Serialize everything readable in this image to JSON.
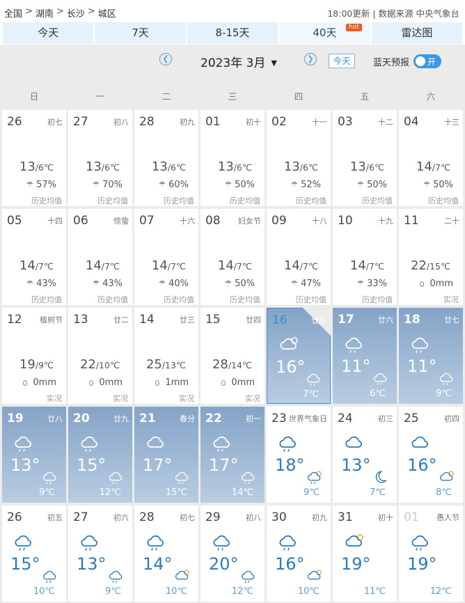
{
  "breadcrumb": [
    "全国",
    "湖南",
    "长沙",
    "城区"
  ],
  "breadcrumb_sep": ">",
  "update_text": "18:00更新 | 数据来源 中央气象台",
  "tabs": [
    {
      "label": "今天"
    },
    {
      "label": "7天"
    },
    {
      "label": "8-15天"
    },
    {
      "label": "40天",
      "badge": "hot",
      "active": true
    },
    {
      "label": "雷达图"
    }
  ],
  "month_label": "2023年  3月",
  "today_label": "今天",
  "lanbei_label": "蓝天预报",
  "toggle_label": "开",
  "weekdays": [
    "日",
    "一",
    "二",
    "三",
    "四",
    "五",
    "六"
  ],
  "colors": {
    "accent": "#3c8ad8",
    "forecast_bg": "#84a3c6",
    "temp_blue": "#2a7bc0"
  },
  "days": [
    {
      "d": "26",
      "lunar": "初七",
      "type": "hist",
      "high": "13",
      "low": "/6℃",
      "p": "57%",
      "note": "历史均值"
    },
    {
      "d": "27",
      "lunar": "初八",
      "type": "hist",
      "high": "13",
      "low": "/6℃",
      "p": "70%",
      "note": "历史均值"
    },
    {
      "d": "28",
      "lunar": "初九",
      "type": "hist",
      "high": "13",
      "low": "/6℃",
      "p": "60%",
      "note": "历史均值"
    },
    {
      "d": "01",
      "lunar": "初十",
      "type": "hist",
      "high": "13",
      "low": "/6℃",
      "p": "50%",
      "note": "历史均值"
    },
    {
      "d": "02",
      "lunar": "十一",
      "type": "hist",
      "high": "13",
      "low": "/6℃",
      "p": "52%",
      "note": "历史均值"
    },
    {
      "d": "03",
      "lunar": "十二",
      "type": "hist",
      "high": "13",
      "low": "/6℃",
      "p": "50%",
      "note": "历史均值"
    },
    {
      "d": "04",
      "lunar": "十三",
      "type": "hist",
      "high": "14",
      "low": "/7℃",
      "p": "50%",
      "note": "历史均值"
    },
    {
      "d": "05",
      "lunar": "十四",
      "type": "hist",
      "high": "14",
      "low": "/7℃",
      "p": "43%",
      "note": "历史均值"
    },
    {
      "d": "06",
      "lunar": "惊蛰",
      "type": "hist",
      "high": "14",
      "low": "/7℃",
      "p": "43%",
      "note": "历史均值"
    },
    {
      "d": "07",
      "lunar": "十六",
      "type": "hist",
      "high": "14",
      "low": "/7℃",
      "p": "40%",
      "note": "历史均值"
    },
    {
      "d": "08",
      "lunar": "妇女节",
      "type": "hist",
      "high": "14",
      "low": "/7℃",
      "p": "50%",
      "note": "历史均值"
    },
    {
      "d": "09",
      "lunar": "十八",
      "type": "hist",
      "high": "14",
      "low": "/7℃",
      "p": "47%",
      "note": "历史均值"
    },
    {
      "d": "10",
      "lunar": "十九",
      "type": "hist",
      "high": "14",
      "low": "/7℃",
      "p": "33%",
      "note": "历史均值"
    },
    {
      "d": "11",
      "lunar": "二十",
      "type": "actual",
      "high": "22",
      "low": "/15℃",
      "p": "0mm",
      "note": "实况"
    },
    {
      "d": "12",
      "lunar": "植树节",
      "type": "actual",
      "high": "19",
      "low": "/9℃",
      "p": "0mm",
      "note": "实况"
    },
    {
      "d": "13",
      "lunar": "廿二",
      "type": "actual",
      "high": "22",
      "low": "/10℃",
      "p": "0mm",
      "note": "实况"
    },
    {
      "d": "14",
      "lunar": "廿三",
      "type": "actual",
      "high": "25",
      "low": "/13℃",
      "p": "1mm",
      "note": "实况"
    },
    {
      "d": "15",
      "lunar": "廿四",
      "type": "actual",
      "high": "28",
      "low": "/14℃",
      "p": "0mm",
      "note": "实况"
    },
    {
      "d": "16",
      "lunar": "廿五",
      "type": "fc",
      "cur": true,
      "today": true,
      "icon": "sun-cloud",
      "icon2": "cloud-rain",
      "high": "16°",
      "low": "7℃"
    },
    {
      "d": "17",
      "lunar": "廿六",
      "type": "fc",
      "cur": true,
      "icon": "cloud-rain",
      "icon2": "cloud-rain",
      "high": "11°",
      "low": "6℃"
    },
    {
      "d": "18",
      "lunar": "廿七",
      "type": "fc",
      "cur": true,
      "icon": "cloud-rain",
      "icon2": "cloud-rain",
      "high": "11°",
      "low": "9℃"
    },
    {
      "d": "19",
      "lunar": "廿八",
      "type": "fc",
      "cur": true,
      "icon": "cloud-rain",
      "icon2": "cloud-rain",
      "high": "13°",
      "low": "9℃"
    },
    {
      "d": "20",
      "lunar": "廿九",
      "type": "fc",
      "cur": true,
      "icon": "cloud-rain",
      "icon2": "cloud-rain",
      "high": "15°",
      "low": "12℃"
    },
    {
      "d": "21",
      "lunar": "春分",
      "type": "fc",
      "cur": true,
      "icon": "cloud",
      "icon2": "cloud-rain",
      "high": "17°",
      "low": "15℃"
    },
    {
      "d": "22",
      "lunar": "初一",
      "type": "fc",
      "cur": true,
      "icon": "cloud-rain",
      "icon2": "cloud-rain",
      "high": "17°",
      "low": "14℃"
    },
    {
      "d": "23",
      "lunar": "世界气象日",
      "type": "fc",
      "icon": "cloud-rain",
      "icon2": "cloud-rain-sun",
      "high": "18°",
      "low": "9℃"
    },
    {
      "d": "24",
      "lunar": "初三",
      "type": "fc",
      "icon": "cloud",
      "icon2": "moon",
      "high": "13°",
      "low": "7℃"
    },
    {
      "d": "25",
      "lunar": "初四",
      "type": "fc",
      "icon": "cloud",
      "icon2": "cloud-sun",
      "high": "16°",
      "low": "8℃"
    },
    {
      "d": "26",
      "lunar": "初五",
      "type": "fc",
      "icon": "cloud-rain",
      "icon2": "cloud-rain",
      "high": "15°",
      "low": "10℃"
    },
    {
      "d": "27",
      "lunar": "初六",
      "type": "fc",
      "icon": "cloud-rain",
      "icon2": "cloud-rain",
      "high": "13°",
      "low": "9℃"
    },
    {
      "d": "28",
      "lunar": "初七",
      "type": "fc",
      "icon": "cloud-rain",
      "icon2": "cloud-sun",
      "high": "14°",
      "low": "10℃"
    },
    {
      "d": "29",
      "lunar": "初八",
      "type": "fc",
      "icon": "cloud-rain",
      "icon2": "cloud-rain",
      "high": "20°",
      "low": "12℃"
    },
    {
      "d": "30",
      "lunar": "初九",
      "type": "fc",
      "icon": "cloud-rain",
      "icon2": "cloud-sun",
      "high": "16°",
      "low": "10℃"
    },
    {
      "d": "31",
      "lunar": "初十",
      "type": "fc",
      "icon": "sun-cloud",
      "icon2": "",
      "high": "19°",
      "low": "11℃"
    },
    {
      "d": "01",
      "lunar": "愚人节",
      "type": "fc",
      "dim": true,
      "icon": "cloud-rain",
      "icon2": "",
      "high": "19°",
      "low": "12℃"
    }
  ]
}
